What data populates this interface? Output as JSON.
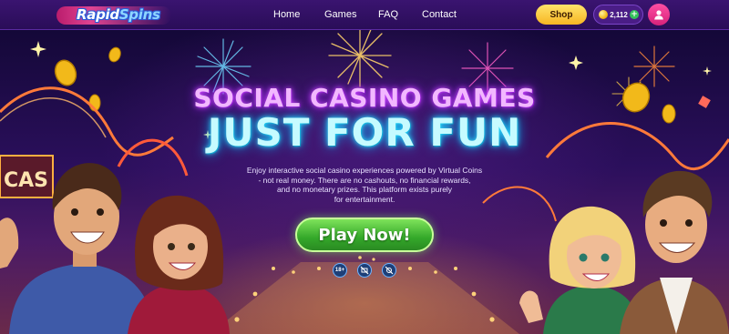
{
  "brand": {
    "name_part1": "Rapid",
    "name_part2": "Spins"
  },
  "nav": {
    "home": "Home",
    "games": "Games",
    "faq": "FAQ",
    "contact": "Contact"
  },
  "header": {
    "shop_label": "Shop",
    "balance": "2,112",
    "plus": "+"
  },
  "hero": {
    "headline_1": "SOCIAL CASINO GAMES",
    "headline_2": "JUST FOR FUN",
    "description_lines": [
      "Enjoy interactive social casino experiences powered by Virtual Coins",
      "- not real money. There are no cashouts, no financial rewards,",
      "and no monetary prizes. This platform exists purely",
      "for entertainment."
    ],
    "cta_label": "Play Now!",
    "badges": [
      "18+",
      "",
      ""
    ]
  },
  "colors": {
    "header_bg": "#3a1470",
    "shop_button": "#f7b623",
    "balance_bg": "#4a1d86",
    "avatar": "#d6217a",
    "headline_1": "#f2b8ff",
    "headline_2": "#c6fbff",
    "cta": "#34a82a"
  },
  "icons": {
    "coin": "coin-icon",
    "plus": "plus-icon",
    "avatar": "user-icon",
    "badge_2": "no-money-icon",
    "badge_3": "no-gambling-icon"
  }
}
